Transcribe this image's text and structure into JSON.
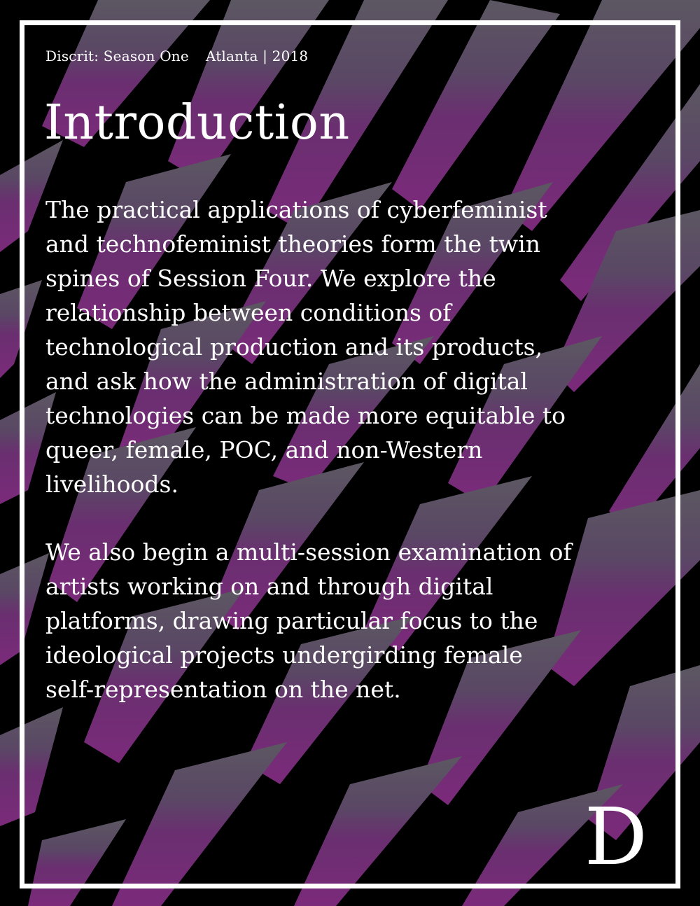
{
  "header": {
    "series": "Discrit: Season One",
    "location": "Atlanta | 2018"
  },
  "title": "Introduction",
  "body": {
    "paragraph_1": "The practical applications of cyberfeminist and technofeminist theories form the twin spines of Session Four. We explore the relationship between conditions of technological production and its products, and ask how the administration of digital technologies can be made more equitable to queer, female, POC, and non-Western livelihoods.",
    "paragraph_2": "We also begin a multi-session examination of artists working on and through digital platforms, drawing particular focus to the ideological projects undergirding female self-representation on the net."
  },
  "logo": {
    "letter": "D"
  },
  "colors": {
    "background": "#000000",
    "stroke_top": "#5a5560",
    "stroke_bottom": "#7b2a7a",
    "frame": "#ffffff",
    "text": "#ffffff"
  }
}
